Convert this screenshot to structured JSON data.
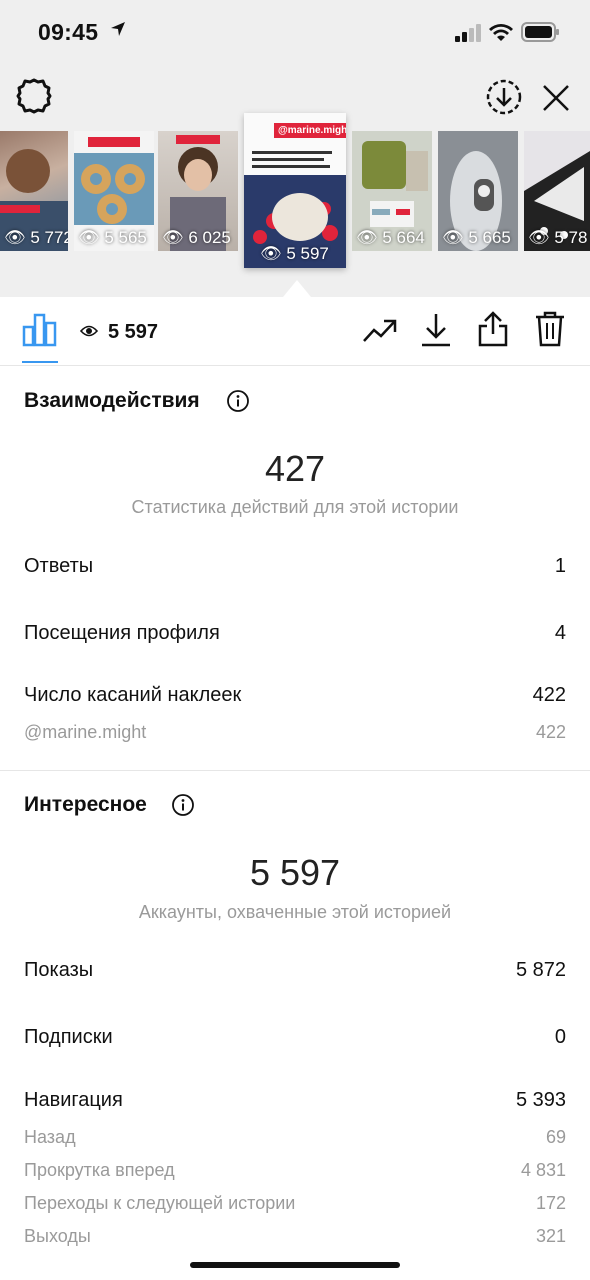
{
  "status_bar": {
    "time": "09:45"
  },
  "thumbnails": [
    {
      "views": "5 772"
    },
    {
      "views": "5 565"
    },
    {
      "views": "6 025"
    },
    {
      "views": "5 597",
      "tag": "@marine.might"
    },
    {
      "views": "5 664"
    },
    {
      "views": "5 665"
    },
    {
      "views": "5 78"
    }
  ],
  "toolbar": {
    "views": "5 597"
  },
  "interactions": {
    "title": "Взаимодействия",
    "total": "427",
    "caption": "Статистика действий для этой истории",
    "rows": [
      {
        "label": "Ответы",
        "value": "1"
      },
      {
        "label": "Посещения профиля",
        "value": "4"
      },
      {
        "label": "Число касаний наклеек",
        "value": "422"
      }
    ],
    "sub": {
      "label": "@marine.might",
      "value": "422"
    }
  },
  "discovery": {
    "title": "Интересное",
    "total": "5 597",
    "caption": "Аккаунты, охваченные этой историей",
    "rows": [
      {
        "label": "Показы",
        "value": "5 872"
      },
      {
        "label": "Подписки",
        "value": "0"
      },
      {
        "label": "Навигация",
        "value": "5 393"
      }
    ],
    "nav_sub": [
      {
        "label": "Назад",
        "value": "69"
      },
      {
        "label": "Прокрутка вперед",
        "value": "4 831"
      },
      {
        "label": "Переходы к следующей истории",
        "value": "172"
      },
      {
        "label": "Выходы",
        "value": "321"
      }
    ]
  },
  "colors": {
    "accent": "#3897f0",
    "muted": "#9a9a9a",
    "tag_red": "#e0243b"
  }
}
